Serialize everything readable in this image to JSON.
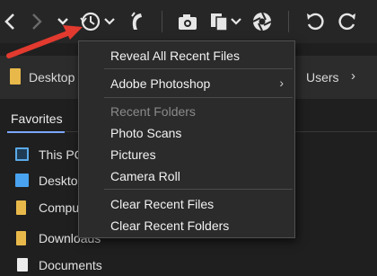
{
  "toolbar": {
    "buttons": [
      {
        "name": "back-button",
        "icon": "chevron-left-icon"
      },
      {
        "name": "forward-button",
        "icon": "chevron-right-icon"
      },
      {
        "name": "recent-locations-button",
        "icon": "chevron-down-icon"
      },
      {
        "name": "recent-files-button",
        "icon": "history-clock-icon"
      },
      {
        "name": "reveal-button",
        "icon": "boomerang-icon"
      },
      {
        "name": "camera-import-button",
        "icon": "camera-icon"
      },
      {
        "name": "copy-from-device-button",
        "icon": "copy-icon"
      },
      {
        "name": "refine-button",
        "icon": "aperture-icon"
      },
      {
        "name": "rotate-ccw-button",
        "icon": "rotate-left-icon"
      },
      {
        "name": "rotate-cw-button",
        "icon": "rotate-right-icon"
      }
    ],
    "accent_color": "#e23a2f"
  },
  "pathbar": {
    "left_item": "Desktop",
    "right_item": "Users",
    "separator": "›"
  },
  "sidebar": {
    "section_title": "Favorites",
    "items": [
      {
        "label": "This PC",
        "icon": "computer-icon"
      },
      {
        "label": "Desktop",
        "icon": "desktop-icon"
      },
      {
        "label": "Computer",
        "icon": "folder-icon"
      },
      {
        "label": "Downloads",
        "icon": "downloads-icon"
      },
      {
        "label": "Documents",
        "icon": "documents-icon"
      }
    ]
  },
  "menu": {
    "reveal_all": "Reveal All Recent Files",
    "photoshop": "Adobe Photoshop",
    "photoshop_chevron": "›",
    "recent_folders_header": "Recent Folders",
    "folders": [
      "Photo Scans",
      "Pictures",
      "Camera Roll"
    ],
    "clear_files": "Clear Recent Files",
    "clear_folders": "Clear Recent Folders"
  }
}
